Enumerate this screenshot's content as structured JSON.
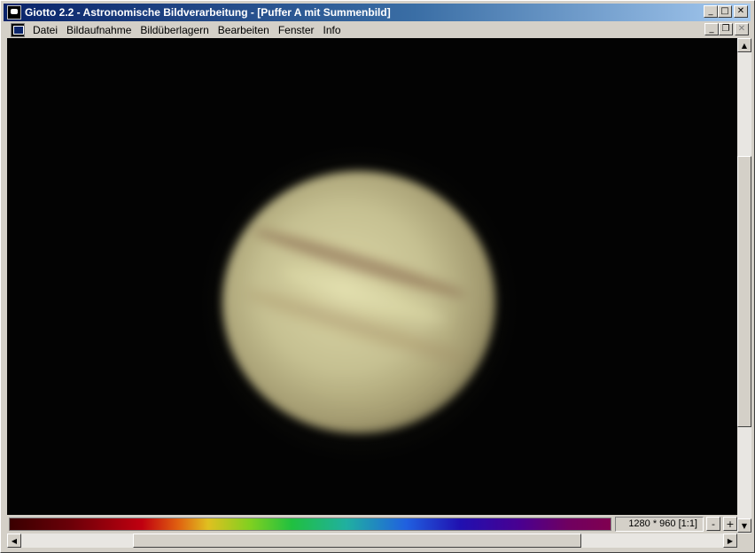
{
  "window": {
    "title": "Giotto 2.2 - Astronomische Bildverarbeitung - [Puffer A mit Summenbild]",
    "icon": "giotto-app-icon",
    "controls": {
      "minimize": "_",
      "maximize": "□",
      "close": "✕"
    }
  },
  "menu": {
    "items": [
      "Datei",
      "Bildaufnahme",
      "Bildüberlagern",
      "Bearbeiten",
      "Fenster",
      "Info"
    ],
    "mdi_controls": {
      "minimize": "_",
      "restore": "❐",
      "close": "✕"
    }
  },
  "image": {
    "subject": "jupiter",
    "background_color": "#030303"
  },
  "status": {
    "resolution": "1280 * 960 [1:1]",
    "zoom_out": "-",
    "zoom_in": "+"
  },
  "scrollbars": {
    "up": "▲",
    "down": "▼",
    "left": "◀",
    "right": "▶"
  }
}
